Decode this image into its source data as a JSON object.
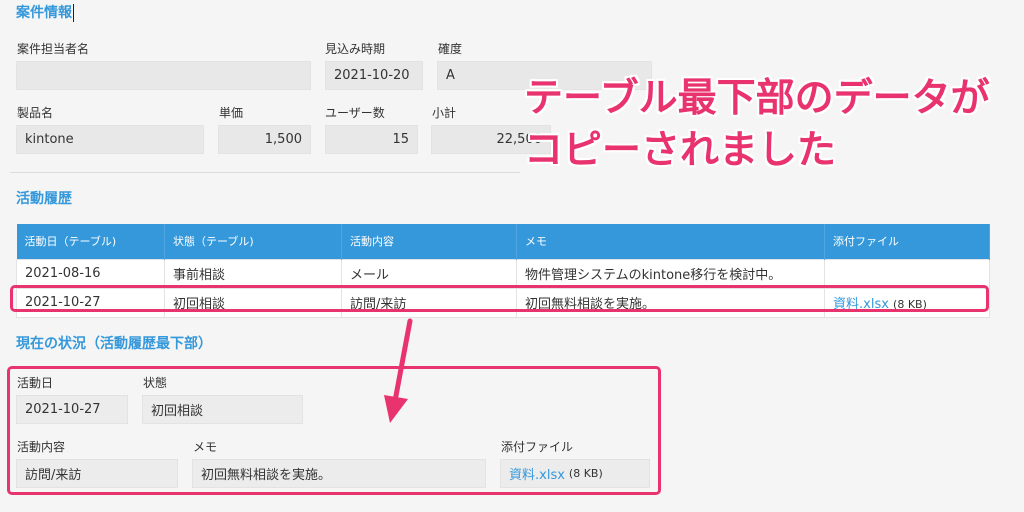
{
  "deal_info": {
    "title": "案件情報",
    "labels": {
      "person_in_charge": "案件担当者名",
      "expected_period": "見込み時期",
      "certainty": "確度",
      "product_name": "製品名",
      "unit_price": "単価",
      "user_count": "ユーザー数",
      "subtotal": "小計"
    },
    "values": {
      "person_in_charge": "",
      "expected_period": "2021-10-20",
      "certainty": "A",
      "product_name": "kintone",
      "unit_price": "1,500",
      "user_count": "15",
      "subtotal": "22,500"
    }
  },
  "activity_history": {
    "title": "活動履歴",
    "columns": [
      "活動日（テーブル)",
      "状態（テーブル)",
      "活動内容",
      "メモ",
      "添付ファイル"
    ],
    "rows": [
      {
        "date": "2021-08-16",
        "status": "事前相談",
        "activity": "メール",
        "memo": "物件管理システムのkintone移行を検討中。",
        "file": "",
        "file_size": ""
      },
      {
        "date": "2021-10-27",
        "status": "初回相談",
        "activity": "訪問/来訪",
        "memo": "初回無料相談を実施。",
        "file": "資料.xlsx",
        "file_size": "(8 KB)"
      }
    ]
  },
  "current_status": {
    "title": "現在の状況（活動履歴最下部）",
    "labels": {
      "date": "活動日",
      "status": "状態",
      "activity": "活動内容",
      "memo": "メモ",
      "attachment": "添付ファイル"
    },
    "values": {
      "date": "2021-10-27",
      "status": "初回相談",
      "activity": "訪問/来訪",
      "memo": "初回無料相談を実施。",
      "file": "資料.xlsx",
      "file_size": "(8 KB)"
    }
  },
  "annotation": {
    "line1": "テーブル最下部のデータが",
    "line2": "コピーされました"
  },
  "colors": {
    "accent": "#3498db",
    "highlight": "#e8336f"
  }
}
